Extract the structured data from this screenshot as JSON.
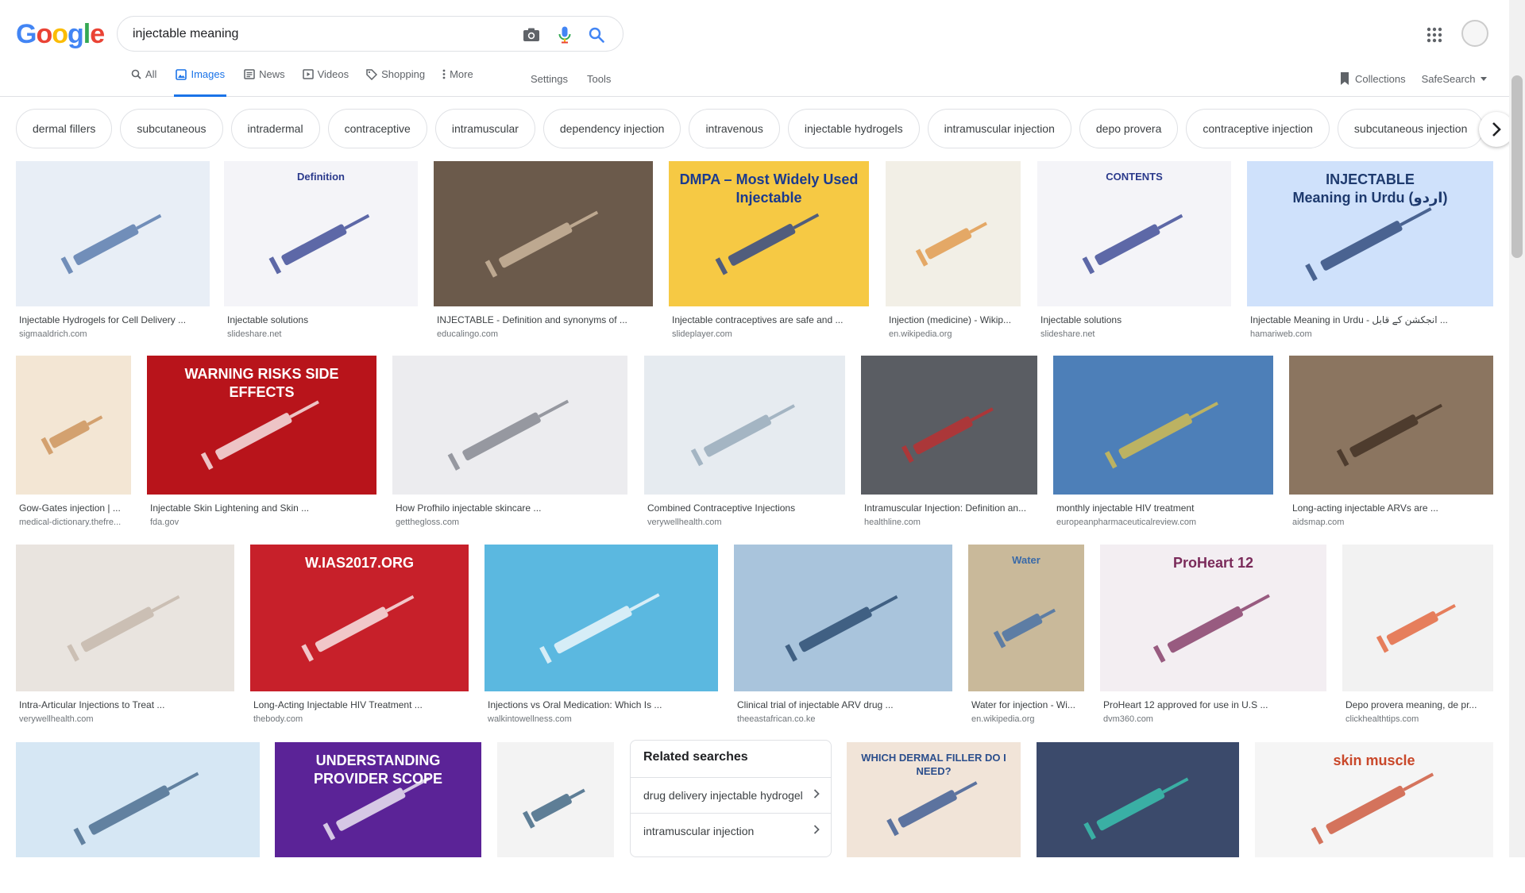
{
  "logo_letters": [
    {
      "ch": "G",
      "color": "#4285F4"
    },
    {
      "ch": "o",
      "color": "#EA4335"
    },
    {
      "ch": "o",
      "color": "#FBBC05"
    },
    {
      "ch": "g",
      "color": "#4285F4"
    },
    {
      "ch": "l",
      "color": "#34A853"
    },
    {
      "ch": "e",
      "color": "#EA4335"
    }
  ],
  "search": {
    "value": "injectable meaning",
    "icons": [
      "camera-icon",
      "mic-icon",
      "search-icon"
    ]
  },
  "tabs": [
    {
      "label": "All",
      "icon": "search-icon",
      "active": false
    },
    {
      "label": "Images",
      "icon": "image-icon",
      "active": true
    },
    {
      "label": "News",
      "icon": "news-icon",
      "active": false
    },
    {
      "label": "Videos",
      "icon": "video-icon",
      "active": false
    },
    {
      "label": "Shopping",
      "icon": "tag-icon",
      "active": false
    },
    {
      "label": "More",
      "icon": "more-icon",
      "active": false
    }
  ],
  "tools": {
    "settings": "Settings",
    "tools": "Tools"
  },
  "right_links": {
    "collections": "Collections",
    "safesearch": "SafeSearch"
  },
  "chips": [
    "dermal fillers",
    "subcutaneous",
    "intradermal",
    "contraceptive",
    "intramuscular",
    "dependency injection",
    "intravenous",
    "injectable hydrogels",
    "intramuscular injection",
    "depo provera",
    "contraceptive injection",
    "subcutaneous injection"
  ],
  "results": [
    {
      "title": "Injectable Hydrogels for Cell Delivery ...",
      "source": "sigmaaldrich.com",
      "bg": "#e8eef6",
      "fg": "#4a6fa5"
    },
    {
      "title": "Injectable solutions",
      "source": "slideshare.net",
      "bg": "#f4f4f8",
      "fg": "#2b3a8c",
      "overlay": "Definition"
    },
    {
      "title": "INJECTABLE - Definition and synonyms of ...",
      "source": "educalingo.com",
      "bg": "#6b5a4b",
      "fg": "#d9c2a8"
    },
    {
      "title": "Injectable contraceptives are safe and ...",
      "source": "slideplayer.com",
      "bg": "#f6c944",
      "fg": "#1a3a8f",
      "overlay": "DMPA – Most Widely Used Injectable"
    },
    {
      "title": "Injection (medicine) - Wikip...",
      "source": "en.wikipedia.org",
      "bg": "#f2efe6",
      "fg": "#e0913c"
    },
    {
      "title": "Injectable solutions",
      "source": "slideshare.net",
      "bg": "#f4f4f8",
      "fg": "#2b3a8c",
      "overlay": "CONTENTS"
    },
    {
      "title": "Injectable Meaning in Urdu - انجکشن کے قابل ...",
      "source": "hamariweb.com",
      "bg": "#cfe1fb",
      "fg": "#1e3a6e",
      "overlay": "INJECTABLE\nMeaning in Urdu (اردو)"
    },
    {
      "title": "Gow-Gates injection | ...",
      "source": "medical-dictionary.thefre...",
      "bg": "#f3e6d4",
      "fg": "#c98a4e"
    },
    {
      "title": "Injectable Skin Lightening and Skin ...",
      "source": "fda.gov",
      "bg": "#b8141b",
      "fg": "#ffffff",
      "overlay": "WARNING RISKS SIDE EFFECTS"
    },
    {
      "title": "How Profhilo injectable skincare ...",
      "source": "getthegloss.com",
      "bg": "#ececef",
      "fg": "#7a7d86"
    },
    {
      "title": "Combined Contraceptive Injections",
      "source": "verywellhealth.com",
      "bg": "#e6ebf0",
      "fg": "#8fa3b5"
    },
    {
      "title": "Intramuscular Injection: Definition an...",
      "source": "healthline.com",
      "bg": "#5a5d63",
      "fg": "#c72b2b"
    },
    {
      "title": "monthly injectable HIV treatment",
      "source": "europeanpharmaceuticalreview.com",
      "bg": "#4d7fb8",
      "fg": "#e2c446"
    },
    {
      "title": "Long-acting injectable ARVs are ...",
      "source": "aidsmap.com",
      "bg": "#8b7560",
      "fg": "#3a2a1e"
    },
    {
      "title": "Intra-Articular Injections to Treat ...",
      "source": "verywellhealth.com",
      "bg": "#e9e4df",
      "fg": "#c1b3a6"
    },
    {
      "title": "Long-Acting Injectable HIV Treatment ...",
      "source": "thebody.com",
      "bg": "#c7202a",
      "fg": "#ffffff",
      "overlay": "W.IAS2017.ORG"
    },
    {
      "title": "Injections vs Oral Medication: Which Is ...",
      "source": "walkintowellness.com",
      "bg": "#5bb8e0",
      "fg": "#ffffff"
    },
    {
      "title": "Clinical trial of injectable ARV drug ...",
      "source": "theeastafrican.co.ke",
      "bg": "#a9c4dc",
      "fg": "#1d3f66"
    },
    {
      "title": "Water for injection - Wi...",
      "source": "en.wikipedia.org",
      "bg": "#c9b99a",
      "fg": "#3a6aa8",
      "overlay": "Water"
    },
    {
      "title": "ProHeart 12 approved for use in U.S ...",
      "source": "dvm360.com",
      "bg": "#f3eef2",
      "fg": "#7a2a5a",
      "overlay": "ProHeart 12"
    },
    {
      "title": "Depo provera meaning, de pr...",
      "source": "clickhealthtips.com",
      "bg": "#f2f2f2",
      "fg": "#e3582a"
    },
    {
      "title": "",
      "source": "",
      "bg": "#d6e7f4",
      "fg": "#3b5f84"
    },
    {
      "title": "",
      "source": "",
      "bg": "#5b2397",
      "fg": "#ffffff",
      "overlay": "UNDERSTANDING PROVIDER SCOPE"
    },
    {
      "title": "",
      "source": "",
      "bg": "#f3f3f3",
      "fg": "#2d5878"
    },
    {
      "title": "",
      "source": "",
      "bg": "#f1e4d8",
      "fg": "#2b4e8c",
      "overlay": "WHICH DERMAL FILLER DO I NEED?"
    },
    {
      "title": "",
      "source": "",
      "bg": "#3b4a6b",
      "fg": "#3ad1b8"
    },
    {
      "title": "",
      "source": "",
      "bg": "#f5f5f5",
      "fg": "#c9482a",
      "overlay": "skin   muscle"
    }
  ],
  "related": {
    "title": "Related searches",
    "items": [
      "drug delivery injectable hydrogel",
      "intramuscular injection"
    ]
  }
}
